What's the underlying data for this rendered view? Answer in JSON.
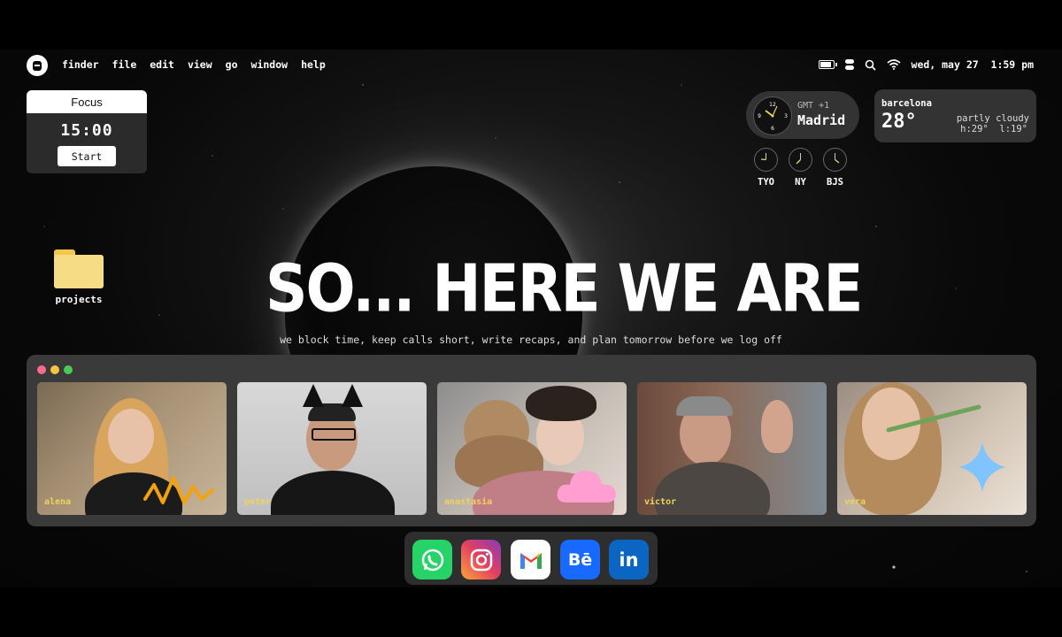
{
  "menubar": {
    "items": [
      "finder",
      "file",
      "edit",
      "view",
      "go",
      "window",
      "help"
    ],
    "datetime": "wed, may 27  1:59 pm",
    "icons": [
      "battery-icon",
      "control-center-icon",
      "search-icon",
      "wifi-icon"
    ]
  },
  "focus": {
    "title": "Focus",
    "time": "15:00",
    "button": "Start"
  },
  "world_clock": {
    "main": {
      "tz": "GMT +1",
      "city": "Madrid"
    },
    "others": [
      "TYO",
      "NY",
      "BJS"
    ]
  },
  "weather": {
    "city": "barcelona",
    "temp": "28°",
    "condition": "partly cloudy",
    "hilo": "h:29°  l:19°"
  },
  "desktop": {
    "folder_label": "projects"
  },
  "hero": {
    "headline": "SO... HERE WE ARE",
    "tagline": "we block time, keep calls short, write recaps, and plan tomorrow before we log off"
  },
  "call": {
    "participants": [
      "alena",
      "peter",
      "anastasia",
      "victor",
      "vera"
    ]
  },
  "dock": {
    "apps": [
      "whatsapp-icon",
      "instagram-icon",
      "gmail-icon",
      "behance-icon",
      "linkedin-icon"
    ],
    "labels": {
      "behance": "Bē",
      "linkedin": "in"
    }
  },
  "colors": {
    "accent_yellow": "#f0d35a",
    "folder": "#f7dc86",
    "window_close": "#ff6b8a",
    "window_min": "#f5c542",
    "window_max": "#4cc95a"
  }
}
